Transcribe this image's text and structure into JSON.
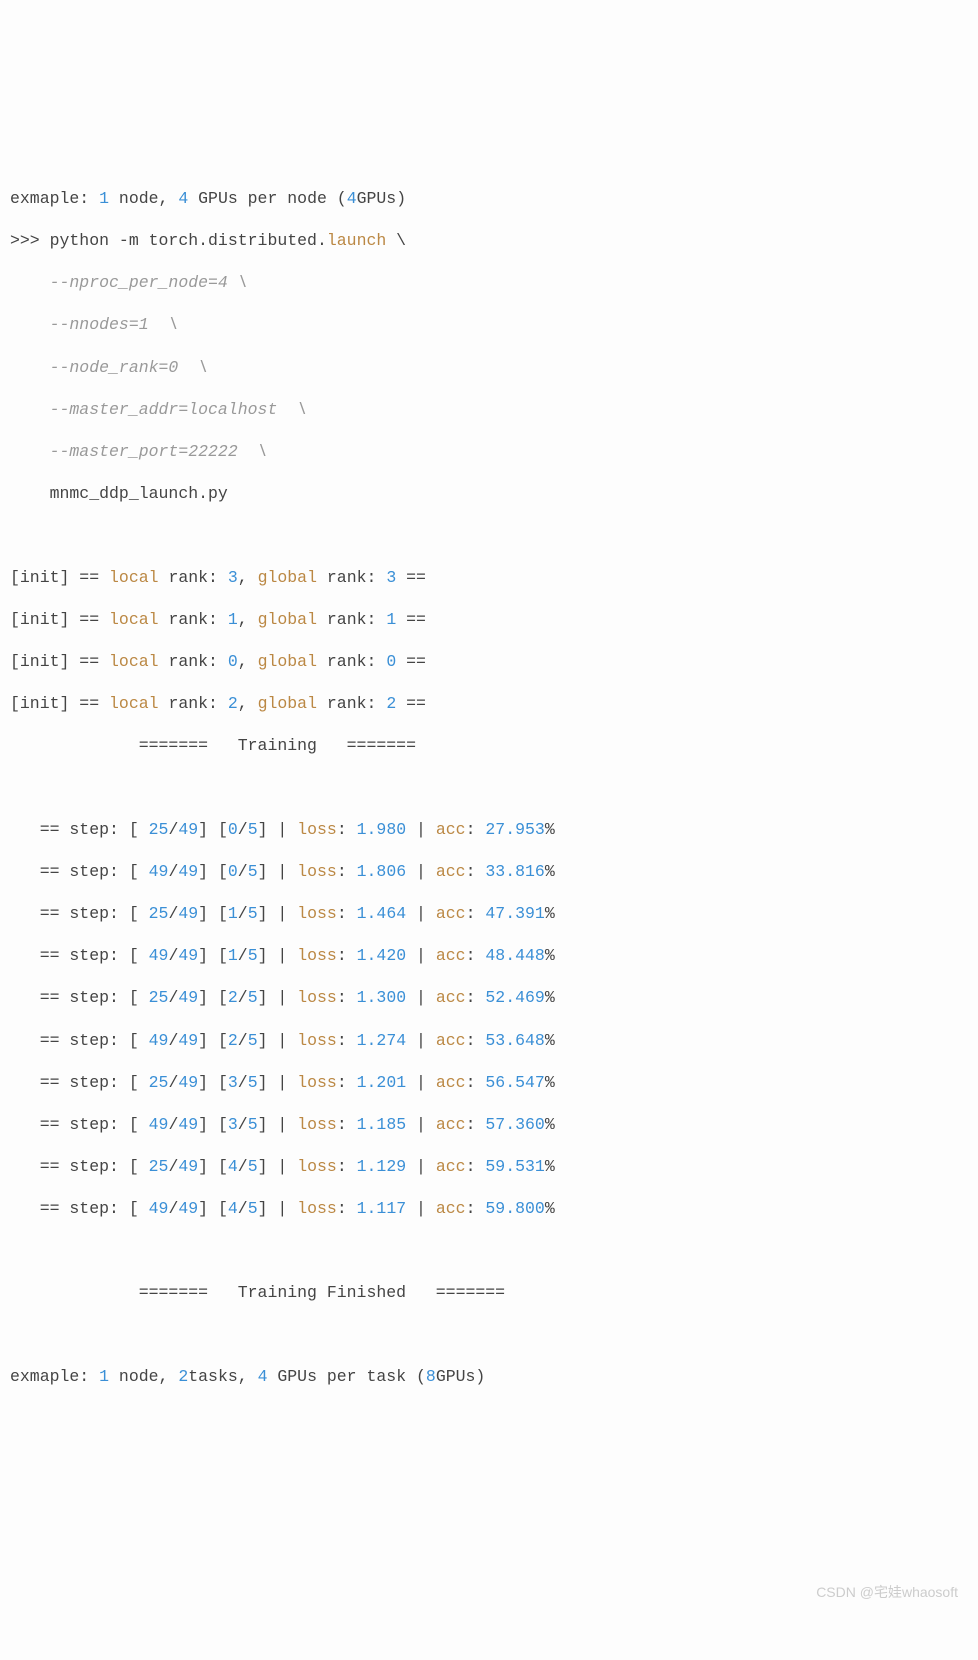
{
  "header1": {
    "prefix": "exmaple: ",
    "nodes": "1",
    "nodes_txt": " node, ",
    "gpus": "4",
    "gpus_txt": " GPUs per node (",
    "total": "4",
    "close": "GPUs)"
  },
  "cmd": {
    "prompt": ">>> python -m torch.distributed.",
    "launch": "launch",
    "slash": " \\",
    "args": [
      "    --nproc_per_node=4 \\",
      "    --nnodes=1  \\",
      "    --node_rank=0  \\",
      "    --master_addr=localhost  \\",
      "    --master_port=22222  \\"
    ],
    "file": "    mnmc_ddp_launch.py"
  },
  "init": [
    {
      "local": "3",
      "global": "3"
    },
    {
      "local": "1",
      "global": "1"
    },
    {
      "local": "0",
      "global": "0"
    },
    {
      "local": "2",
      "global": "2"
    }
  ],
  "init_txt": {
    "open": "[init] == ",
    "local": "local",
    "rank": " rank: ",
    "comma": ", ",
    "global": "global",
    "close": " =="
  },
  "training_header": "             =======   Training   =======",
  "steps": [
    {
      "cur": "25",
      "tot": "49",
      "e": "0",
      "et": "5",
      "loss": "1.980",
      "acc": "27.953"
    },
    {
      "cur": "49",
      "tot": "49",
      "e": "0",
      "et": "5",
      "loss": "1.806",
      "acc": "33.816"
    },
    {
      "cur": "25",
      "tot": "49",
      "e": "1",
      "et": "5",
      "loss": "1.464",
      "acc": "47.391"
    },
    {
      "cur": "49",
      "tot": "49",
      "e": "1",
      "et": "5",
      "loss": "1.420",
      "acc": "48.448"
    },
    {
      "cur": "25",
      "tot": "49",
      "e": "2",
      "et": "5",
      "loss": "1.300",
      "acc": "52.469"
    },
    {
      "cur": "49",
      "tot": "49",
      "e": "2",
      "et": "5",
      "loss": "1.274",
      "acc": "53.648"
    },
    {
      "cur": "25",
      "tot": "49",
      "e": "3",
      "et": "5",
      "loss": "1.201",
      "acc": "56.547"
    },
    {
      "cur": "49",
      "tot": "49",
      "e": "3",
      "et": "5",
      "loss": "1.185",
      "acc": "57.360"
    },
    {
      "cur": "25",
      "tot": "49",
      "e": "4",
      "et": "5",
      "loss": "1.129",
      "acc": "59.531"
    },
    {
      "cur": "49",
      "tot": "49",
      "e": "4",
      "et": "5",
      "loss": "1.117",
      "acc": "59.800"
    }
  ],
  "step_txt": {
    "prefix": "   == step: [ ",
    "slash": "/",
    "b1": "] [",
    "b2": "] | ",
    "loss": "loss",
    "colon": ": ",
    "pipe": " | ",
    "acc": "acc",
    "pct": "%"
  },
  "training_footer": "             =======   Training Finished   =======",
  "header2": {
    "prefix": "exmaple: ",
    "nodes": "1",
    "nodes_txt": " node, ",
    "tasks": "2",
    "tasks_txt": "tasks, ",
    "gpus": "4",
    "gpus_txt": " GPUs per task (",
    "total": "8",
    "close": "GPUs)"
  },
  "watermark": "CSDN @宅娃whaosoft"
}
